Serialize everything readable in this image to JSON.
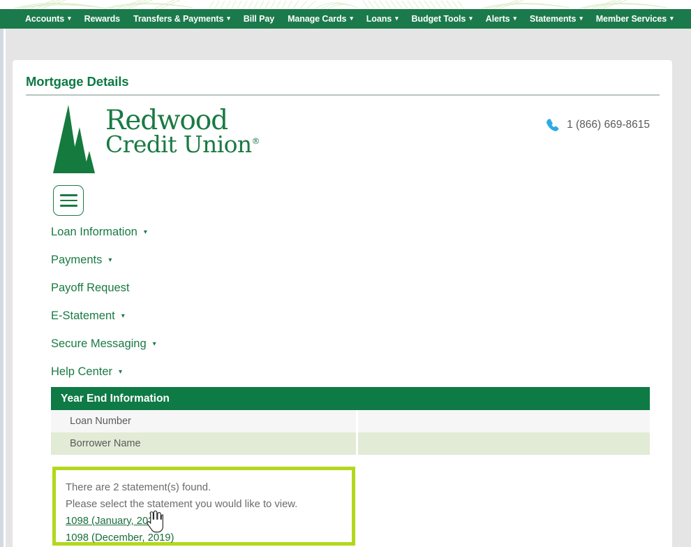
{
  "topnav": {
    "items": [
      {
        "label": "Accounts",
        "caret": true
      },
      {
        "label": "Rewards",
        "caret": false
      },
      {
        "label": "Transfers & Payments",
        "caret": true
      },
      {
        "label": "Bill Pay",
        "caret": false
      },
      {
        "label": "Manage Cards",
        "caret": true
      },
      {
        "label": "Loans",
        "caret": true
      },
      {
        "label": "Budget Tools",
        "caret": true
      },
      {
        "label": "Alerts",
        "caret": true
      },
      {
        "label": "Statements",
        "caret": true
      },
      {
        "label": "Member Services",
        "caret": true
      }
    ]
  },
  "page": {
    "title": "Mortgage Details"
  },
  "brand": {
    "line1": "Redwood",
    "line2": "Credit Union",
    "registered": "®",
    "logo_icon": "redwood-trees-icon"
  },
  "contact": {
    "phone": "1 (866) 669-8615",
    "phone_icon": "phone-icon",
    "phone_icon_color": "#2aabe4"
  },
  "menu": {
    "toggle_icon": "hamburger-icon",
    "items": [
      {
        "label": "Loan Information",
        "caret": "▾"
      },
      {
        "label": "Payments",
        "caret": "▾"
      },
      {
        "label": "Payoff Request",
        "caret": ""
      },
      {
        "label": "E-Statement",
        "caret": "▾"
      },
      {
        "label": "Secure Messaging",
        "caret": "▾"
      },
      {
        "label": "Help Center",
        "caret": "▾"
      }
    ]
  },
  "year_end_table": {
    "header": "Year End Information",
    "rows": [
      {
        "label": "Loan Number",
        "value": ""
      },
      {
        "label": "Borrower Name",
        "value": ""
      }
    ]
  },
  "statements": {
    "found_text": "There are 2 statement(s) found.",
    "instruction": "Please select the statement you would like to view.",
    "links": [
      {
        "label": "1098 (January, 2021)",
        "hovered": true
      },
      {
        "label": "1098 (December, 2019)",
        "hovered": false
      }
    ],
    "highlight_color": "#b2d81c"
  },
  "colors": {
    "brand_green": "#1a7a43",
    "nav_green": "#1b7a4b",
    "header_green": "#0e7a45",
    "row_green": "#e2ebd5",
    "row_gray": "#f6f6f6"
  },
  "cursor": {
    "icon": "pointer-hand-cursor"
  }
}
